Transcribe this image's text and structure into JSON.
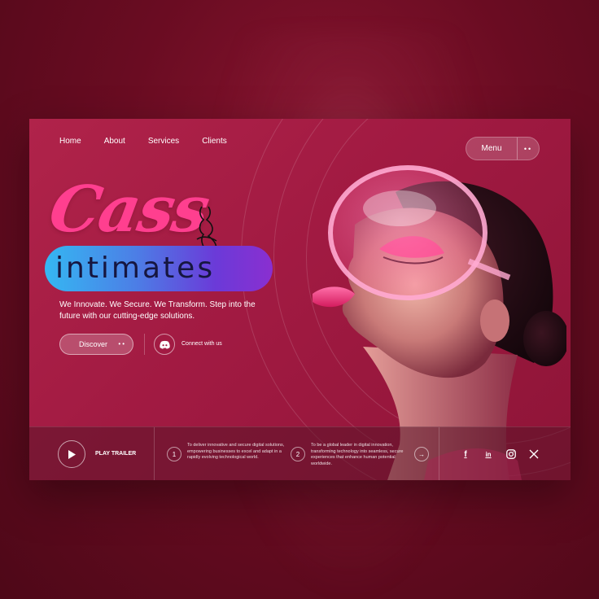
{
  "nav": {
    "items": [
      {
        "label": "Home"
      },
      {
        "label": "About"
      },
      {
        "label": "Services"
      },
      {
        "label": "Clients"
      }
    ]
  },
  "menu": {
    "label": "Menu",
    "dots": "••"
  },
  "brand": {
    "script": "Cass",
    "word": "intimates"
  },
  "hero": {
    "tagline": "We Innovate. We Secure. We Transform. Step into the future with our cutting-edge solutions.",
    "discover_label": "Discover",
    "discover_dots": "••",
    "connect_label": "Connect with us"
  },
  "bottom": {
    "play_label": "PLAY TRAILER",
    "items": [
      {
        "number": "1",
        "text": "To deliver innovative and secure digital solutions, empowering businesses to excel and adapt in a rapidly evolving technological world."
      },
      {
        "number": "2",
        "text": "To be a global leader in digital innovation, transforming technology into seamless, secure experiences that enhance human potential worldwide."
      }
    ],
    "arrow": "→",
    "socials": [
      {
        "icon": "facebook-icon",
        "glyph": "f"
      },
      {
        "icon": "linkedin-icon",
        "glyph": "in"
      },
      {
        "icon": "instagram-icon",
        "glyph": ""
      },
      {
        "icon": "x-icon",
        "glyph": "𝕏"
      }
    ]
  },
  "colors": {
    "card": "#a11a42",
    "background": "#6a0c22",
    "brand_pink": "#ff3f8f",
    "pill_start": "#35b7f2",
    "pill_end": "#8a2fd0"
  }
}
